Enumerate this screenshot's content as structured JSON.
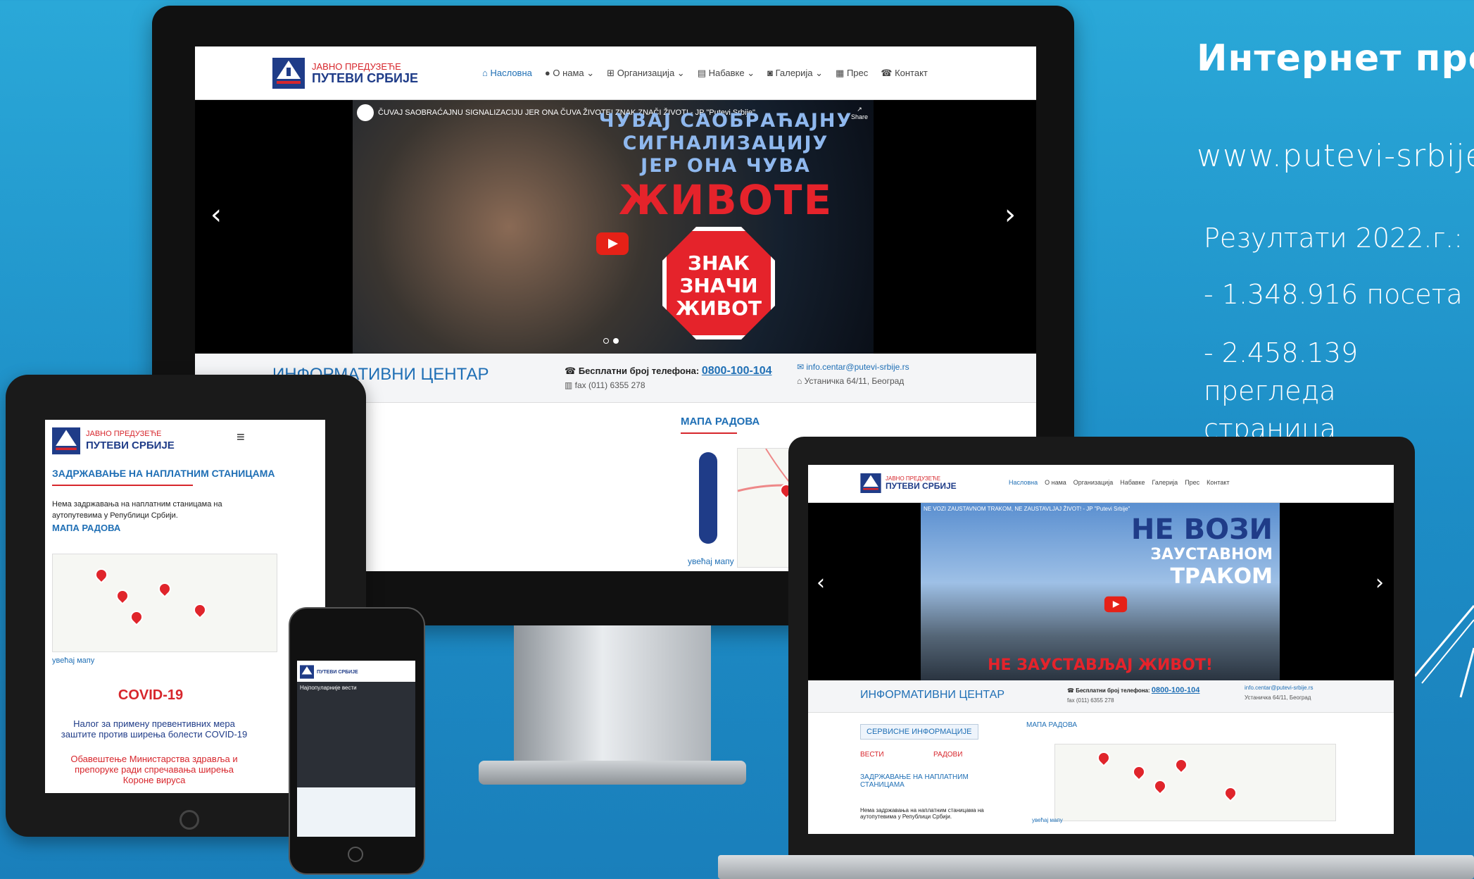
{
  "headline": {
    "title": "Интернет презентација",
    "url": "www.putevi-srbije.rs",
    "results_label": "Резултати 2022.г.:",
    "visits": "- 1.348.916 посета",
    "views": "- 2.458.139 прегледа страница"
  },
  "site": {
    "logo_top": "ЈАВНО ПРЕДУЗЕЋЕ",
    "logo_bottom": "ПУТЕВИ СРБИЈЕ",
    "nav": [
      "Насловна",
      "О нама",
      "Организација",
      "Набавке",
      "Галерија",
      "Прес",
      "Контакт"
    ],
    "info_center": "ИНФОРМАТИВНИ ЦЕНТАР",
    "free_phone_label": "Бесплатни број телефона:",
    "free_phone": "0800-100-104",
    "fax": "fax (011) 6355 278",
    "email": "info.centar@putevi-srbije.rs",
    "address": "Устаничка 64/11, Београд",
    "map_title": "МАПА РАДОВА",
    "enlarge_map": "увећај мапу",
    "service_info": "СЕРВИСНЕ ИНФОРМАЦИЈЕ",
    "news": "ВЕСТИ",
    "works": "РАДОВИ",
    "toll_title": "ЗАДРЖАВАЊЕ НА НАПЛАТНИМ СТАНИЦАМА",
    "toll_text": "Нема задржавања на наплатним станицама на аутопутевима у Републици Србији.",
    "covid_title": "COVID-19",
    "covid_link1": "Налог за примену превентивних мера заштите против ширења болести COVID-19",
    "covid_link2": "Обавештење Министарства здравља и препоруке ради спречавања ширења Короне вируса"
  },
  "monitor_video": {
    "caption": "ČUVAJ SAOBRAĆAJNU SIGNALIZACIJU JER ONA ČUVA ŽIVOTE! ZNAK ZNAČI ŽIVOT! - JP \"Putevi Srbije\"",
    "line1": "ЧУВАЈ САОБРАЋАЈНУ",
    "line2": "СИГНАЛИЗАЦИЈУ",
    "line3": "ЈЕР ОНА ЧУВА",
    "line4": "ЖИВОТЕ",
    "sign1": "ЗНАК",
    "sign2": "ЗНАЧИ",
    "sign3": "ЖИВОТ",
    "share": "Share"
  },
  "laptop_video": {
    "caption": "NE VOZI ZAUSTAVNOM TRAKOM, NE ZAUSTAVLJAJ ŽIVOT! - JP \"Putevi Srbije\"",
    "line1": "НЕ ВОЗИ",
    "line2": "ЗАУСТАВНОМ",
    "line3": "ТРАКОМ",
    "line4": "НЕ ЗАУСТАВЉАЈ ЖИВОТ!"
  },
  "phone": {
    "header": "Најпопуларније вести"
  },
  "colors": {
    "background": "#1d8dc6",
    "brand_blue": "#1f3c88",
    "brand_red": "#d7262c",
    "link_blue": "#1f6fb5"
  }
}
